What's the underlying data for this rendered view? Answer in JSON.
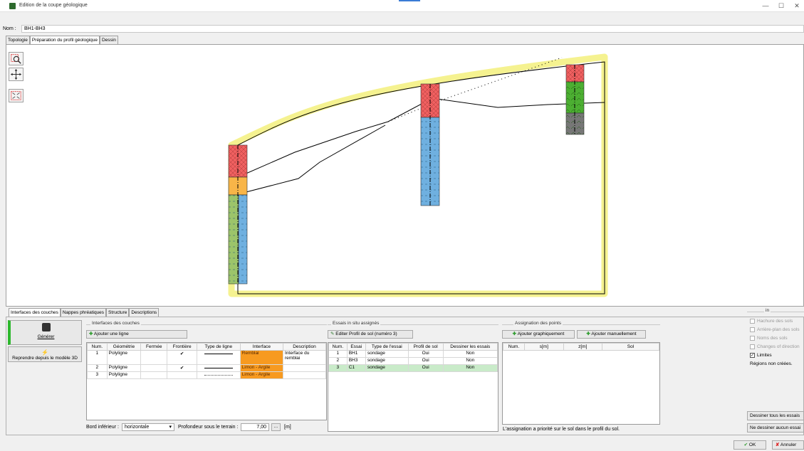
{
  "window": {
    "title": "Edition de la coupe géologique",
    "minimize": "—",
    "maximize": "☐",
    "close": "✕"
  },
  "name": {
    "label": "Nom :",
    "value": "BH1-BH3"
  },
  "top_tabs": [
    "Topologie",
    "Préparation du profil géologique",
    "Dessin"
  ],
  "tools": [
    "zoom-window-icon",
    "pan-icon",
    "zoom-extents-icon"
  ],
  "bottom_tabs": [
    "Interfaces des couches",
    "Nappes phréatiques",
    "Structure",
    "Descriptions"
  ],
  "left_actions": {
    "generate_label": "Générer",
    "rebuild_label": "Reprendre depuis le modèle 3D"
  },
  "interfaces": {
    "group_title": "Interfaces des couches",
    "add_row_label": "Ajouter une ligne",
    "columns": [
      "Num.",
      "Géométrie",
      "Fermée",
      "Frontière",
      "Type de ligne",
      "Interface",
      "Description"
    ],
    "rows": [
      {
        "num": "1",
        "geometry": "Polyligne",
        "closed": "",
        "boundary": "✔",
        "line_type": "solid",
        "interface": "Remblai",
        "description": "Interface du remblai"
      },
      {
        "num": "2",
        "geometry": "Polyligne",
        "closed": "",
        "boundary": "✔",
        "line_type": "solid",
        "interface": "Limon - Argile",
        "description": ""
      },
      {
        "num": "3",
        "geometry": "Polyligne",
        "closed": "",
        "boundary": "",
        "line_type": "dotted",
        "interface": "Limon - Argile",
        "description": ""
      }
    ],
    "bottom_edge_label": "Bord inférieur :",
    "bottom_edge_value": "horizontale",
    "depth_label": "Profondeur sous le terrain :",
    "depth_value": "7,00",
    "depth_button": "...",
    "depth_unit": "[m]"
  },
  "tests": {
    "group_title": "Essais in situ assignés",
    "edit_label": "Editer Profil de sol (numéro 3)",
    "columns": [
      "Num.",
      "Essai",
      "Type de l'essai",
      "Profil de sol",
      "Dessiner les essais"
    ],
    "rows": [
      {
        "num": "1",
        "test": "BH1",
        "type": "sondage",
        "profile": "Oui",
        "draw": "Non"
      },
      {
        "num": "2",
        "test": "BH3",
        "type": "sondage",
        "profile": "Oui",
        "draw": "Non"
      },
      {
        "num": "3",
        "test": "C1",
        "type": "sondage",
        "profile": "Oui",
        "draw": "Non"
      }
    ]
  },
  "points": {
    "group_title": "Assignation des points",
    "add_graphic_label": "Ajouter graphiquement",
    "add_manual_label": "Ajouter manuellement",
    "columns": [
      "Num.",
      "s[m]",
      "z[m]",
      "Sol"
    ],
    "note": "L'assignation a priorité sur le sol dans le profil du sol."
  },
  "right_panel": {
    "group_title": "in",
    "options": [
      {
        "label": "Hachure des sols",
        "checked": false,
        "enabled": false
      },
      {
        "label": "Arrière-plan des sols",
        "checked": false,
        "enabled": false
      },
      {
        "label": "Noms des sols",
        "checked": false,
        "enabled": false
      },
      {
        "label": "Changes of direction",
        "checked": false,
        "enabled": false
      },
      {
        "label": "Limites",
        "checked": true,
        "enabled": true
      }
    ],
    "status": "Régions non créées.",
    "draw_all_label": "Dessiner tous les essais",
    "draw_none_label": "Ne dessiner aucun essai"
  },
  "footer": {
    "ok_label": "OK",
    "cancel_label": "Annuler"
  },
  "colors": {
    "remblai": "#f79a20",
    "highlight": "#f5f290",
    "red_layer": "#f06060",
    "blue_layer": "#6fb0e0",
    "green_layer": "#4caf32",
    "grey_layer": "#777777",
    "selected_row": "#c9ebc9"
  }
}
